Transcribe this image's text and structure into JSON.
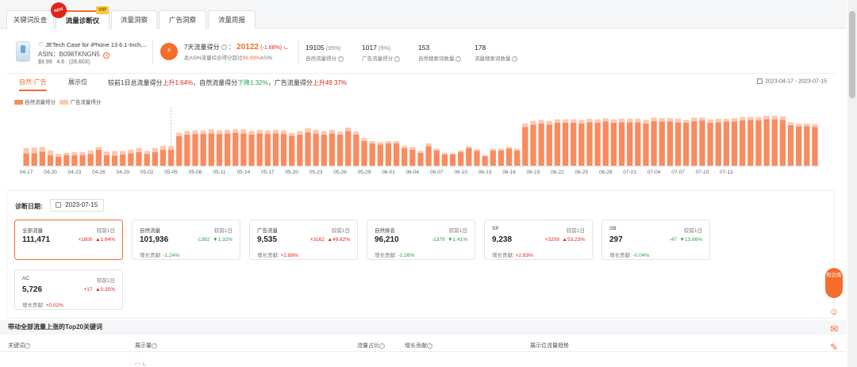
{
  "tabs": [
    {
      "label": "关键词反查"
    },
    {
      "label": "流量诊断仪"
    },
    {
      "label": "流量洞察"
    },
    {
      "label": "广告洞察"
    },
    {
      "label": "流量周报"
    }
  ],
  "badges": {
    "new": "NEW",
    "vip": "VIP"
  },
  "product": {
    "title": "JETech Case for iPhone 13 6.1-Inch,...",
    "asin_prefix": "ASIN：",
    "asin": "B098TKNGN5",
    "price": "$9.99",
    "rating": "4.6",
    "reviews": "(28,603)"
  },
  "score": {
    "label": "7天流量得分",
    "value": "20122",
    "delta": "(-1.68%)",
    "sub_prefix": "此ASIN流量综合得分超过",
    "sub_pct": "99.99%",
    "sub_suffix": "ASIN"
  },
  "stats": [
    {
      "value": "19105",
      "pct": "(95%)",
      "label": "自然流量得分"
    },
    {
      "value": "1017",
      "pct": "(5%)",
      "label": "广告流量得分"
    },
    {
      "value": "153",
      "pct": "",
      "label": "自然搜索词数量"
    },
    {
      "value": "178",
      "pct": "",
      "label": "流量搜索词数量"
    }
  ],
  "chart_panel": {
    "tab_natural_ad": "自然·广告",
    "tab_display": "展示位",
    "summary": {
      "p1": "较前1日总流量得分",
      "v1": "上升1.64%",
      "p2": "，自然流量得分",
      "v2": "下降1.32%",
      "p3": "，广告流量得分",
      "v3": "上升49.37%"
    },
    "date_from": "2023-04-17",
    "date_sep": " - ",
    "date_to": "2023-07-15",
    "legend_natural": "自然流量得分",
    "legend_ad": "广告流量得分"
  },
  "chart_data": {
    "type": "bar",
    "stacked": true,
    "colors": {
      "natural": "#f88b5f",
      "ad": "#fcc8b1"
    },
    "series": [
      {
        "name": "自然流量得分",
        "values": [
          21,
          21,
          24,
          18,
          15,
          18,
          18,
          18,
          20,
          27,
          18,
          17,
          19,
          21,
          23,
          20,
          23,
          27,
          27,
          50,
          53,
          54,
          54,
          55,
          54,
          55,
          56,
          55,
          53,
          55,
          54,
          55,
          54,
          51,
          53,
          57,
          55,
          53,
          55,
          53,
          59,
          53,
          42,
          38,
          36,
          38,
          38,
          30,
          27,
          22,
          33,
          26,
          19,
          19,
          23,
          30,
          25,
          16,
          26,
          26,
          29,
          26,
          66,
          70,
          72,
          70,
          73,
          73,
          73,
          72,
          74,
          73,
          75,
          73,
          74,
          74,
          74,
          72,
          76,
          75,
          75,
          74,
          73,
          76,
          77,
          73,
          74,
          75,
          75,
          77,
          78,
          77,
          79,
          79,
          78,
          69,
          67,
          67,
          66
        ]
      },
      {
        "name": "广告流量得分",
        "values": [
          9,
          10,
          8,
          8,
          5,
          4,
          5,
          5,
          6,
          5,
          6,
          8,
          6,
          6,
          7,
          5,
          7,
          7,
          6,
          6,
          6,
          6,
          6,
          7,
          6,
          6,
          6,
          7,
          6,
          6,
          6,
          6,
          6,
          5,
          6,
          7,
          6,
          6,
          6,
          5,
          6,
          5,
          5,
          4,
          4,
          4,
          4,
          4,
          5,
          3,
          5,
          3,
          3,
          2,
          3,
          3,
          3,
          2,
          3,
          3,
          3,
          3,
          6,
          6,
          6,
          6,
          6,
          6,
          6,
          6,
          6,
          6,
          6,
          6,
          6,
          6,
          6,
          6,
          6,
          6,
          6,
          6,
          5,
          6,
          5,
          6,
          6,
          5,
          6,
          6,
          5,
          6,
          6,
          6,
          6,
          5,
          5,
          5,
          5
        ]
      }
    ],
    "x_ticks": [
      "04-17",
      "04-20",
      "04-23",
      "04-26",
      "04-29",
      "05-02",
      "05-05",
      "05-08",
      "05-11",
      "05-14",
      "05-17",
      "05-20",
      "05-23",
      "05-26",
      "05-29",
      "06-01",
      "06-04",
      "06-07",
      "06-10",
      "06-13",
      "06-16",
      "06-19",
      "06-22",
      "06-25",
      "06-28",
      "07-01",
      "07-04",
      "07-07",
      "07-10",
      "07-13"
    ],
    "ylim": [
      0,
      100
    ],
    "grid": false
  },
  "diagnosis": {
    "label": "诊断日期:",
    "date": "2023-07-15",
    "contrib_label": "增长贡献:",
    "cards": [
      {
        "title": "全部流量",
        "compare": "较前1日",
        "value": "111,471",
        "delta": "+1800",
        "pct": "▲1.64%",
        "dir": "up",
        "contrib": ""
      },
      {
        "title": "自然流量",
        "compare": "较前1日",
        "value": "101,936",
        "delta": "-1362",
        "pct": "▼1.32%",
        "dir": "down",
        "contrib": "-1.24%"
      },
      {
        "title": "广告流量",
        "compare": "较前1日",
        "value": "9,535",
        "delta": "+3162",
        "pct": "▲49.62%",
        "dir": "up",
        "contrib": "+2.88%"
      },
      {
        "title": "自然排名",
        "compare": "较前1日",
        "value": "96,210",
        "delta": "-1379",
        "pct": "▼1.41%",
        "dir": "down",
        "contrib": "-1.26%"
      },
      {
        "title": "SP",
        "compare": "较前1日",
        "value": "9,238",
        "delta": "+3209",
        "pct": "▲53.23%",
        "dir": "up",
        "contrib": "+2.93%"
      },
      {
        "title": "SB",
        "compare": "较前1日",
        "value": "297",
        "delta": "-47",
        "pct": "▼13.66%",
        "dir": "down",
        "contrib": "-0.04%"
      },
      {
        "title": "AC",
        "compare": "较前1日",
        "value": "5,726",
        "delta": "+17",
        "pct": "▲0.30%",
        "dir": "up",
        "contrib": "+0.02%"
      }
    ]
  },
  "top20": {
    "title": "带动全部流量上涨的Top20关键词",
    "headers": [
      "关键词",
      "展示量",
      "流量占比",
      "增长贡献",
      "展示位流量趋势"
    ],
    "cut_value": "- - ∟"
  },
  "float_panel": {
    "label": "知识库"
  },
  "icons": [
    "cal-icon",
    "question-icon",
    "heart-icon",
    "support-icon",
    "chat-icon",
    "edit-icon"
  ]
}
